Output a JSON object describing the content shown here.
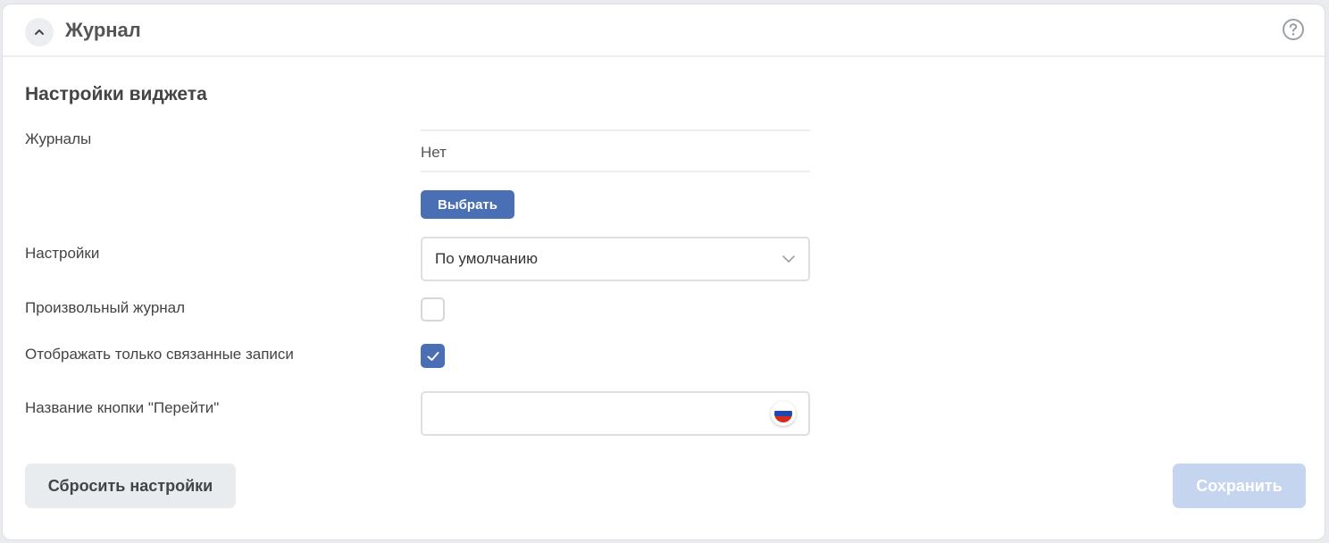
{
  "header": {
    "title": "Журнал",
    "collapse_icon": "chevron-up-icon",
    "help_icon": "question-circle-icon"
  },
  "form": {
    "section_title": "Настройки виджета",
    "journals": {
      "label": "Журналы",
      "value": "Нет",
      "choose_label": "Выбрать"
    },
    "settings": {
      "label": "Настройки",
      "selected": "По умолчанию",
      "arrow_icon": "chevron-down-icon"
    },
    "custom_journal": {
      "label": "Произвольный журнал",
      "checked": false
    },
    "linked_only": {
      "label": "Отображать только связанные записи",
      "checked": true
    },
    "goto_button_name": {
      "label": "Название кнопки \"Перейти\"",
      "value": "",
      "language_icon": "russian-flag-icon"
    }
  },
  "footer": {
    "reset_label": "Сбросить настройки",
    "save_label": "Сохранить"
  },
  "colors": {
    "accent": "#4b6fb5",
    "save_disabled": "#c5d5ef",
    "reset_bg": "#e9ecef"
  }
}
